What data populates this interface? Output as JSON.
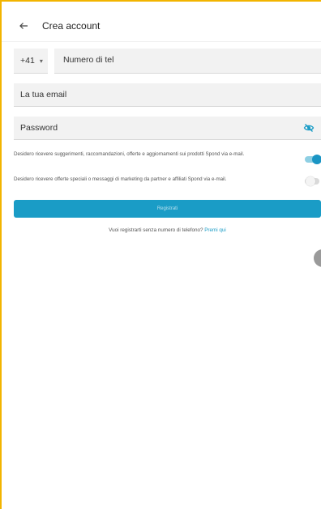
{
  "header": {
    "back_icon": "arrow-left-icon",
    "title": "Crea account"
  },
  "form": {
    "country_code": "+41",
    "phone_placeholder": "Numero di tel",
    "email_placeholder": "La tua email",
    "password_placeholder": "Password",
    "password_icon": "eye-off-icon"
  },
  "consents": [
    {
      "text": "Desidero ricevere suggerimenti, raccomandazioni, offerte e aggiornamenti sui prodotti Spond via e-mail.",
      "enabled": true
    },
    {
      "text": "Desidero ricevere offerte speciali o messaggi di marketing da partner e affiliati Spond via e-mail.",
      "enabled": false
    }
  ],
  "register_button": {
    "label": "Registrati"
  },
  "no_phone": {
    "text": "Vuoi registrarti senza numero di telefono?",
    "link": "Premi qui"
  },
  "colors": {
    "accent": "#1a9cc6",
    "frame": "#f2b400"
  }
}
